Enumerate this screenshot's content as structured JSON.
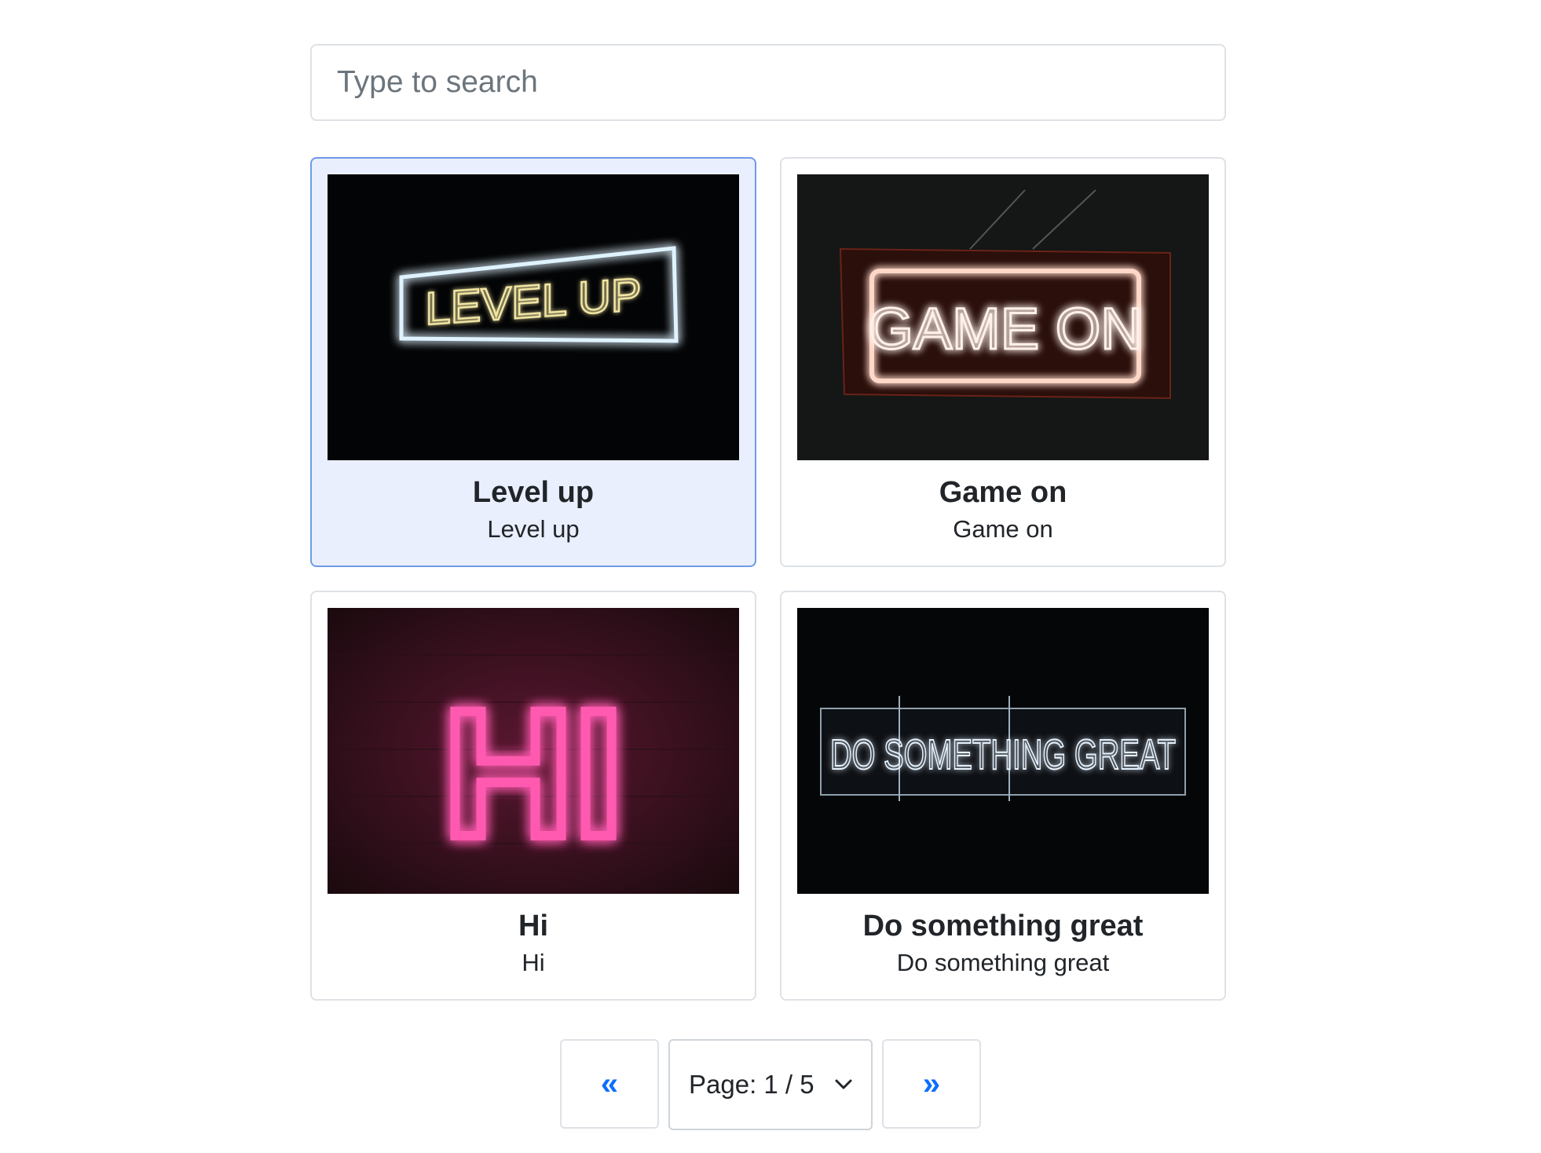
{
  "search": {
    "placeholder": "Type to search",
    "value": ""
  },
  "cards": [
    {
      "title": "Level up",
      "subtitle": "Level up",
      "image_text": "LEVEL UP",
      "selected": true
    },
    {
      "title": "Game on",
      "subtitle": "Game on",
      "image_text": "GAME ON",
      "selected": false
    },
    {
      "title": "Hi",
      "subtitle": "Hi",
      "image_text": "HI",
      "selected": false
    },
    {
      "title": "Do something great",
      "subtitle": "Do something great",
      "image_text": "DO SOMETHING GREAT",
      "selected": false
    }
  ],
  "pagination": {
    "prev_label": "«",
    "next_label": "»",
    "page_label": "Page: 1 / 5",
    "current_page": 1,
    "total_pages": 5
  },
  "colors": {
    "accent": "#0d6efd",
    "selected_bg": "#e9effc",
    "selected_border": "#6f9ae6",
    "border": "#dee2e6"
  }
}
